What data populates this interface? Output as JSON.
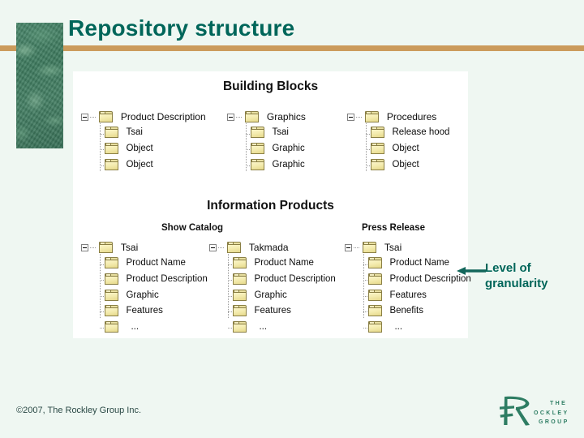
{
  "slide": {
    "title": "Repository structure",
    "accent_color": "#00665a",
    "rule_color": "#cb9b5c",
    "background_color": "#eff7f2",
    "panel_color": "#ffffff"
  },
  "diagram": {
    "sections": [
      {
        "id": "building-blocks",
        "heading": "Building Blocks",
        "trees": [
          {
            "group_label": "",
            "root": "Product Description",
            "children": [
              "Tsai",
              "Object",
              "Object"
            ]
          },
          {
            "group_label": "",
            "root": "Graphics",
            "children": [
              "Tsai",
              "Graphic",
              "Graphic"
            ]
          },
          {
            "group_label": "",
            "root": "Procedures",
            "children": [
              "Release hood",
              "Object",
              "Object"
            ]
          }
        ]
      },
      {
        "id": "information-products",
        "heading": "Information Products",
        "trees": [
          {
            "group_label": "Show Catalog",
            "root": "Tsai",
            "children": [
              "Product Name",
              "Product Description",
              "Graphic",
              "Features",
              "..."
            ]
          },
          {
            "group_label": "",
            "root": "Takmada",
            "children": [
              "Product Name",
              "Product Description",
              "Graphic",
              "Features",
              "..."
            ]
          },
          {
            "group_label": "Press Release",
            "root": "Tsai",
            "children": [
              "Product Name",
              "Product Description",
              "Features",
              "Benefits",
              "..."
            ]
          }
        ]
      }
    ]
  },
  "annotation": {
    "line1": "Level of",
    "line2": "granularity",
    "arrow_direction": "left",
    "color": "#00665a"
  },
  "footer": {
    "copyright": "©2007, The Rockley Group Inc.",
    "logo": {
      "monogram": "R",
      "line1": "THE",
      "line2": "ROCKLEY",
      "line3": "GROUP",
      "color": "#2e7d63"
    }
  }
}
